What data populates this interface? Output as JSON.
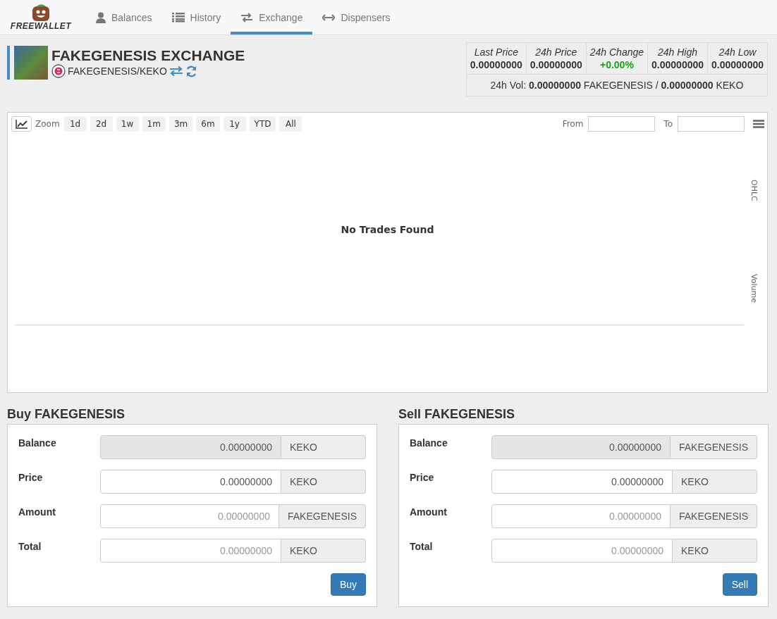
{
  "nav": {
    "logo_text": "FREEWALLET",
    "tabs": [
      {
        "label": "Balances",
        "selected": false
      },
      {
        "label": "History",
        "selected": false
      },
      {
        "label": "Exchange",
        "selected": true
      },
      {
        "label": "Dispensers",
        "selected": false
      }
    ]
  },
  "header": {
    "title": "FAKEGENESIS EXCHANGE",
    "pair": "FAKEGENESIS/KEKO"
  },
  "stats": {
    "cells": [
      {
        "label": "Last Price",
        "value": "0.00000000",
        "kind": "plain"
      },
      {
        "label": "24h Price",
        "value": "0.00000000",
        "kind": "plain"
      },
      {
        "label": "24h Change",
        "value": "+0.00%",
        "kind": "change"
      },
      {
        "label": "24h High",
        "value": "0.00000000",
        "kind": "plain"
      },
      {
        "label": "24h Low",
        "value": "0.00000000",
        "kind": "plain"
      }
    ],
    "volume": "24h Vol: **0.00000000** FAKEGENESIS / **0.00000000** KEKO"
  },
  "chart": {
    "zoom_label": "Zoom",
    "ranges": [
      "1d",
      "2d",
      "1w",
      "1m",
      "3m",
      "6m",
      "1y",
      "YTD",
      "All"
    ],
    "from_label": "From",
    "to_label": "To",
    "message": "No Trades Found",
    "axis_labels": [
      "OHLC",
      "Volume"
    ]
  },
  "forms": [
    {
      "title": "Buy FAKEGENESIS",
      "button": "Buy",
      "fields": [
        {
          "label": "Balance",
          "value": "0.00000000",
          "disabled": true,
          "unit": "KEKO"
        },
        {
          "label": "Price",
          "value": "0.00000000",
          "disabled": false,
          "unit": "KEKO"
        },
        {
          "label": "Amount",
          "placeholder": "0.00000000",
          "disabled": false,
          "unit": "FAKEGENESIS"
        },
        {
          "label": "Total",
          "placeholder": "0.00000000",
          "disabled": false,
          "unit": "KEKO"
        }
      ]
    },
    {
      "title": "Sell FAKEGENESIS",
      "button": "Sell",
      "fields": [
        {
          "label": "Balance",
          "value": "0.00000000",
          "disabled": true,
          "unit": "FAKEGENESIS"
        },
        {
          "label": "Price",
          "value": "0.00000000",
          "disabled": false,
          "unit": "KEKO"
        },
        {
          "label": "Amount",
          "placeholder": "0.00000000",
          "disabled": false,
          "unit": "FAKEGENESIS"
        },
        {
          "label": "Total",
          "placeholder": "0.00000000",
          "disabled": false,
          "unit": "KEKO"
        }
      ]
    }
  ]
}
